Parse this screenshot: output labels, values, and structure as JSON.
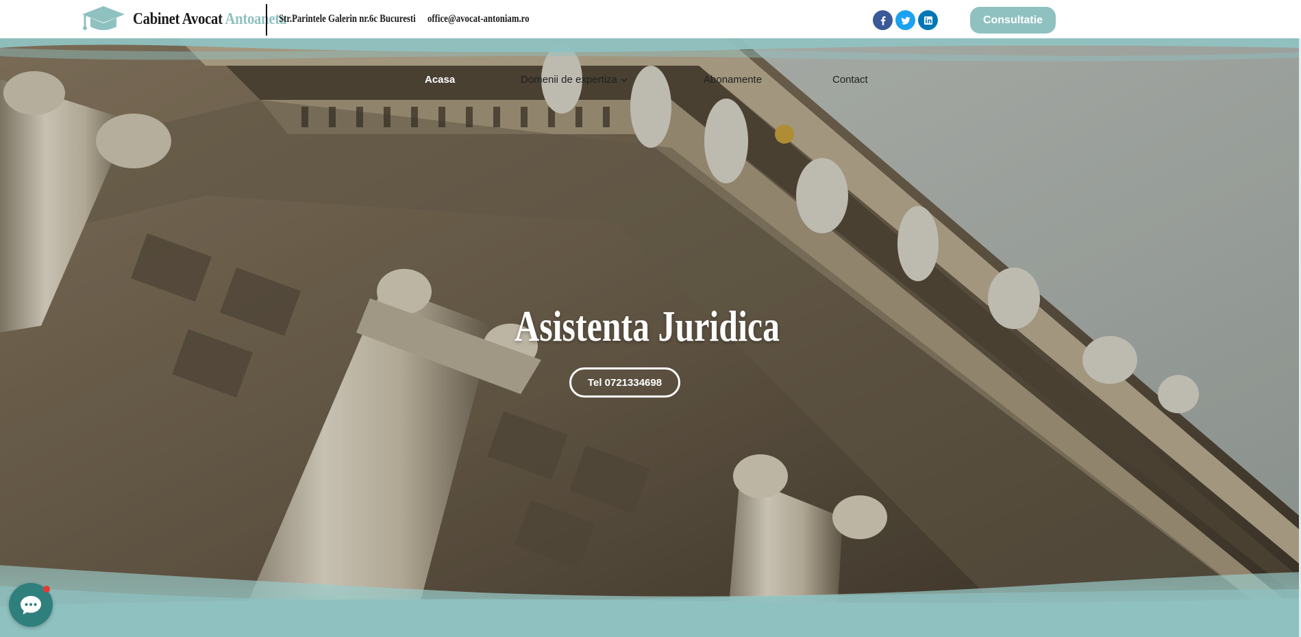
{
  "header": {
    "logo_name": "Cabinet Avocat ",
    "logo_accent": "Antoaneta",
    "address": "Str.Parintele Galerin nr.6c Bucuresti",
    "email": "office@avocat-antoniam.ro",
    "consult_label": "Consultatie",
    "social": [
      "facebook-icon",
      "twitter-icon",
      "linkedin-icon"
    ]
  },
  "nav": {
    "items": [
      {
        "label": "Acasa",
        "active": true
      },
      {
        "label": "Domenii de expertiza",
        "has_dropdown": true
      },
      {
        "label": "Abonamente"
      },
      {
        "label": "Contact"
      }
    ]
  },
  "hero": {
    "title": "Asistenta Juridica",
    "cta_label": "Tel 0721334698"
  },
  "colors": {
    "accent": "#8fc1c0",
    "chat": "#2f7f7d",
    "notification": "#e53935"
  }
}
